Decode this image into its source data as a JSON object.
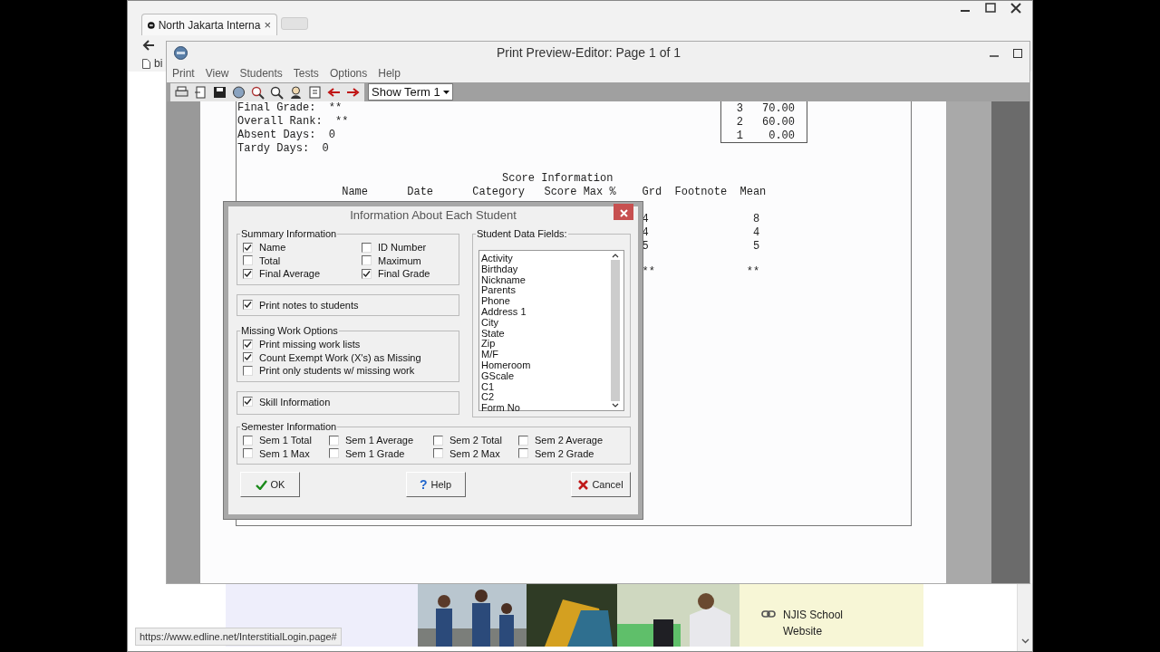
{
  "browser": {
    "tab_title": "North Jakarta Interna",
    "tab_close": "×",
    "bookmark": "bi",
    "page_link": "NJIS School Website",
    "status_url": "https://www.edline.net/InterstitialLogin.page#"
  },
  "app": {
    "title": "Print Preview-Editor:  Page 1 of 1",
    "menu": [
      "Print",
      "View",
      "Students",
      "Tests",
      "Options",
      "Help"
    ],
    "term_select": "Show Term 1",
    "report": {
      "summary_lines": [
        "Final Grade:  **",
        "Overall Rank:  **",
        "Absent Days:  0",
        "Tardy Days:  0"
      ],
      "rank_rows": [
        {
          "rank": "3",
          "value": "70.00"
        },
        {
          "rank": "2",
          "value": "60.00"
        },
        {
          "rank": "1",
          "value": "0.00"
        }
      ],
      "score_title": "Score Information",
      "score_columns": [
        "Name",
        "Date",
        "Category",
        "Score",
        "Max",
        "%",
        "Grd",
        "Footnote",
        "Mean"
      ],
      "score_rows": [
        {
          "grd": "4",
          "mean": "8"
        },
        {
          "grd": "4",
          "mean": "4"
        },
        {
          "grd": "5",
          "mean": "5"
        },
        {
          "grd": "**",
          "mean": "**"
        }
      ]
    }
  },
  "dialog": {
    "title": "Information About Each Student",
    "summary": {
      "legend": "Summary Information",
      "items": [
        {
          "label": "Name",
          "checked": true
        },
        {
          "label": "Total",
          "checked": false
        },
        {
          "label": "Final Average",
          "checked": true
        },
        {
          "label": "ID Number",
          "checked": false
        },
        {
          "label": "Maximum",
          "checked": false
        },
        {
          "label": "Final Grade",
          "checked": true
        }
      ]
    },
    "print_notes": {
      "label": "Print notes to students",
      "checked": true
    },
    "missing_work": {
      "legend": "Missing Work Options",
      "items": [
        {
          "label": "Print missing work lists",
          "checked": true
        },
        {
          "label": "Count Exempt Work (X's) as Missing",
          "checked": true
        },
        {
          "label": "Print only students w/ missing work",
          "checked": false
        }
      ]
    },
    "skill": {
      "label": "Skill Information",
      "checked": true
    },
    "student_fields": {
      "legend": "Student Data Fields:",
      "items": [
        "Activity",
        "Birthday",
        "Nickname",
        "Parents",
        "Phone",
        "Address 1",
        "City",
        "State",
        "Zip",
        "M/F",
        "Homeroom",
        "GScale",
        "C1",
        "C2",
        "Form No"
      ]
    },
    "semester": {
      "legend": "Semester Information",
      "items": [
        {
          "label": "Sem 1 Total",
          "checked": false
        },
        {
          "label": "Sem 1 Average",
          "checked": false
        },
        {
          "label": "Sem 2 Total",
          "checked": false
        },
        {
          "label": "Sem 2 Average",
          "checked": false
        },
        {
          "label": "Sem 1 Max",
          "checked": false
        },
        {
          "label": "Sem 1 Grade",
          "checked": false
        },
        {
          "label": "Sem 2 Max",
          "checked": false
        },
        {
          "label": "Sem 2 Grade",
          "checked": false
        }
      ]
    },
    "buttons": [
      {
        "kind": "ok",
        "label": "OK"
      },
      {
        "kind": "help",
        "label": "Help",
        "icon": "?"
      },
      {
        "kind": "cancel",
        "label": "Cancel"
      }
    ]
  }
}
